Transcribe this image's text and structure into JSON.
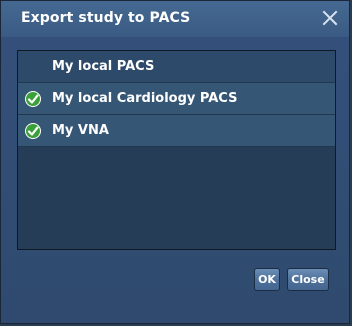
{
  "dialog": {
    "title": "Export study to PACS",
    "close_icon": "close-icon"
  },
  "destinations": [
    {
      "label": "My local PACS",
      "checked": false
    },
    {
      "label": "My local Cardiology PACS",
      "checked": true
    },
    {
      "label": "My VNA",
      "checked": true
    }
  ],
  "buttons": {
    "ok_label": "OK",
    "close_label": "Close"
  },
  "colors": {
    "check_green": "#3aa13a",
    "title_bar": "#3f628a",
    "list_background": "#263d57"
  }
}
